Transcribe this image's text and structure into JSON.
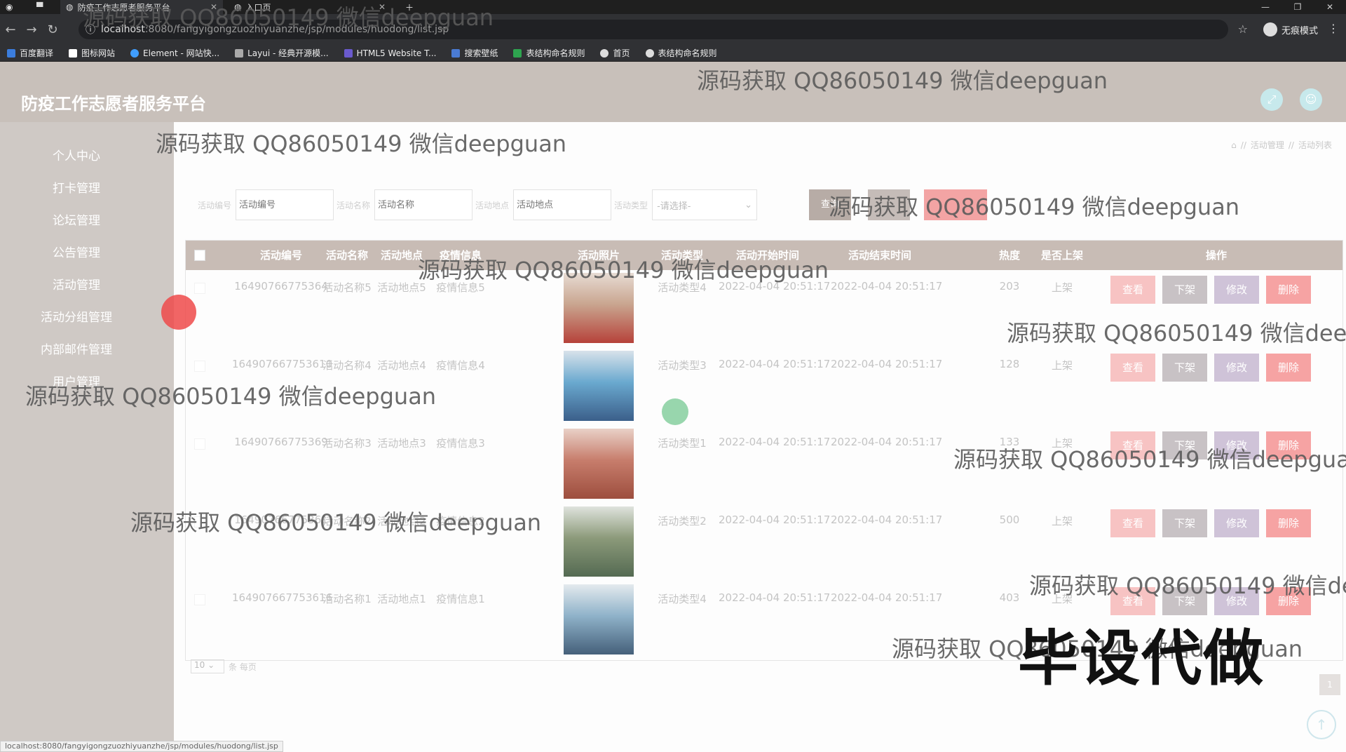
{
  "browser": {
    "tabs": [
      {
        "title": "防疫工作志愿者服务平台",
        "active": true
      },
      {
        "title": "入口页",
        "active": false
      }
    ],
    "url_host": "localhost",
    "url_path": ":8080/fangyigongzuozhiyuanzhe/jsp/modules/huodong/list.jsp",
    "profile_label": "无痕模式",
    "bookmarks": [
      "百度翻译",
      "图标网站",
      "Element - 网站快...",
      "Layui - 经典开源模...",
      "HTML5 Website T...",
      "搜索壁纸",
      "表结构命名规则",
      "首页",
      "表结构命名规则"
    ],
    "status_url": "localhost:8080/fangyigongzuozhiyuanzhe/jsp/modules/huodong/list.jsp"
  },
  "app": {
    "title": "防疫工作志愿者服务平台",
    "colors": {
      "header": "#c8c0ba",
      "sidebar": "#cfc9c5",
      "accent_icon": "#c7e9ec",
      "danger": "#f6a3a3"
    }
  },
  "sidebar": {
    "items": [
      {
        "label": "个人中心"
      },
      {
        "label": "打卡管理"
      },
      {
        "label": "论坛管理"
      },
      {
        "label": "公告管理"
      },
      {
        "label": "活动管理"
      },
      {
        "label": "活动分组管理"
      },
      {
        "label": "内部邮件管理"
      },
      {
        "label": "用户管理"
      }
    ]
  },
  "breadcrumb": {
    "items": [
      "活动管理",
      "活动列表"
    ],
    "separator": "//"
  },
  "filters": {
    "fields": [
      {
        "label": "活动编号",
        "placeholder": "活动编号"
      },
      {
        "label": "活动名称",
        "placeholder": "活动名称"
      },
      {
        "label": "活动地点",
        "placeholder": "活动地点"
      }
    ],
    "type_label": "活动类型",
    "type_selected": "-请选择-",
    "search_label": "查询"
  },
  "table": {
    "headers": [
      "活动编号",
      "活动名称",
      "活动地点",
      "疫情信息",
      "活动照片",
      "活动类型",
      "活动开始时间",
      "活动结束时间",
      "热度",
      "是否上架",
      "操作"
    ],
    "action_labels": {
      "view": "查看",
      "down": "下架",
      "edit": "修改",
      "delete": "删除"
    },
    "rows": [
      {
        "id": "16490766775364",
        "name": "活动名称5",
        "place": "活动地点5",
        "info": "疫情信息5",
        "type": "活动类型4",
        "start": "2022-04-04 20:51:17",
        "end": "2022-04-04 20:51:17",
        "heat": "203",
        "status": "上架",
        "photo_colors": [
          "#c9a58f",
          "#e7dcd4",
          "#b6423a"
        ]
      },
      {
        "id": "164907667753610",
        "name": "活动名称4",
        "place": "活动地点4",
        "info": "疫情信息4",
        "type": "活动类型3",
        "start": "2022-04-04 20:51:17",
        "end": "2022-04-04 20:51:17",
        "heat": "128",
        "status": "上架",
        "photo_colors": [
          "#6aa9cf",
          "#d8e2ea",
          "#3b5f8a"
        ]
      },
      {
        "id": "16490766775369",
        "name": "活动名称3",
        "place": "活动地点3",
        "info": "疫情信息3",
        "type": "活动类型1",
        "start": "2022-04-04 20:51:17",
        "end": "2022-04-04 20:51:17",
        "heat": "133",
        "status": "上架",
        "photo_colors": [
          "#c77d6c",
          "#e9d1c7",
          "#9d4e3e"
        ]
      },
      {
        "id": "16490766775361",
        "name": "活动名称2",
        "place": "活动地点2",
        "info": "疫情信息2",
        "type": "活动类型2",
        "start": "2022-04-04 20:51:17",
        "end": "2022-04-04 20:51:17",
        "heat": "500",
        "status": "上架",
        "photo_colors": [
          "#8c9a7a",
          "#dfe3dd",
          "#546a52"
        ]
      },
      {
        "id": "164907667753616",
        "name": "活动名称1",
        "place": "活动地点1",
        "info": "疫情信息1",
        "type": "活动类型4",
        "start": "2022-04-04 20:51:17",
        "end": "2022-04-04 20:51:17",
        "heat": "403",
        "status": "上架",
        "photo_colors": [
          "#8fb2c9",
          "#e4eaee",
          "#45607a"
        ]
      }
    ]
  },
  "pagination": {
    "page_size": "10",
    "page_size_suffix": "条 每页",
    "current_page": "1"
  },
  "watermarks": {
    "source_text": "源码获取 QQ86050149 微信deepguan",
    "big_text": "毕设代做"
  }
}
